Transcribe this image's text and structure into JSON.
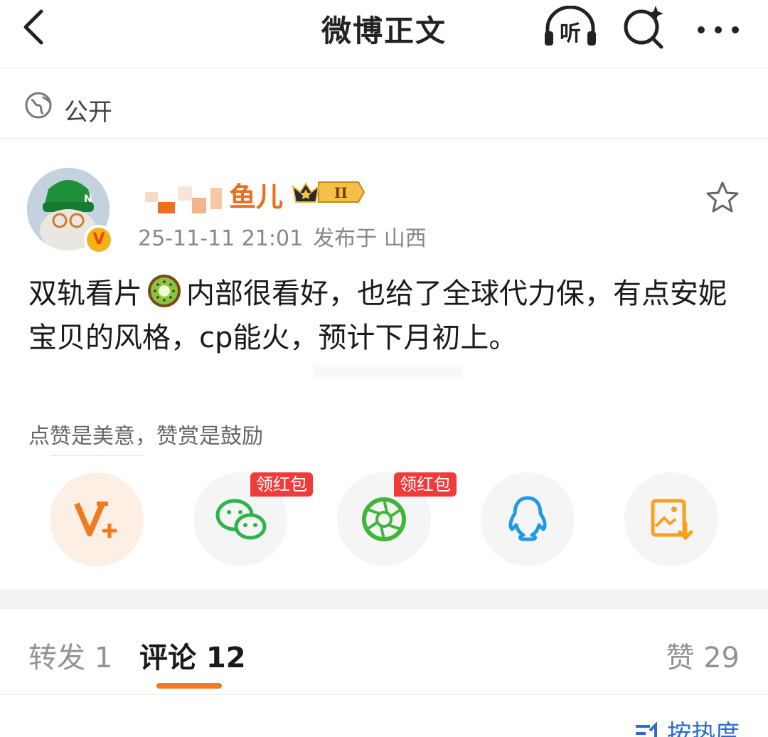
{
  "header": {
    "title": "微博正文",
    "listen_label": "听"
  },
  "visibility": {
    "label": "公开"
  },
  "author": {
    "name_visible": "鱼儿",
    "verified_badge": "V",
    "level_badge": "II",
    "timestamp": "25-11-11 21:01",
    "location": "发布于 山西"
  },
  "post": {
    "text_part1": "双轨看片",
    "emoji": "kiwi-icon",
    "text_part2": "内部很看好，也给了全球代力保，有点安妮宝贝的风格，cp能火，预计下月初上。"
  },
  "reward": {
    "text": "点赞是美意，赞赏是鼓励"
  },
  "share": {
    "tag_label_1": "领红包",
    "tag_label_2": "领红包",
    "icons": [
      "v-plus-icon",
      "wechat-icon",
      "moments-icon",
      "qq-icon",
      "save-image-icon"
    ]
  },
  "tabs": {
    "repost": "转发 1",
    "comment": "评论 12",
    "like": "赞 29"
  },
  "sort": {
    "label": "按热度"
  },
  "colors": {
    "accent": "#f27a20",
    "username": "#eb6e1d",
    "tag_red": "#f23a3a",
    "link_blue": "#2a6bd8"
  }
}
